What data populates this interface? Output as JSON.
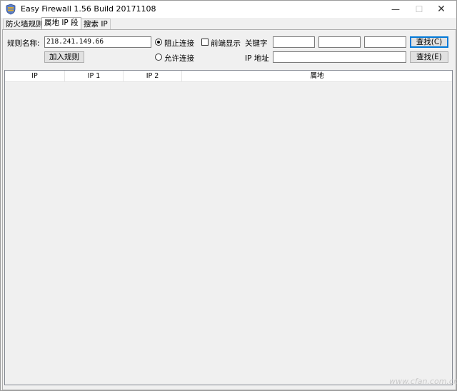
{
  "window": {
    "title": "Easy Firewall 1.56 Build 20171108",
    "minimize": "—",
    "maximize": "☐",
    "close": "✕"
  },
  "tabs": [
    {
      "label": "防火墙规则"
    },
    {
      "label": "属地 IP 段"
    },
    {
      "label": "搜索 IP"
    }
  ],
  "form": {
    "rule_name_label": "规则名称:",
    "rule_name_value": "218.241.149.66",
    "add_rule_button": "加入规则",
    "block_label": "阻止连接",
    "allow_label": "允许连接",
    "front_display_label": "前端显示",
    "keyword_label": "关键字",
    "ip_address_label": "IP 地址",
    "keyword_values": [
      "",
      "",
      ""
    ],
    "ip_address_value": "",
    "search_c_button": "查找(C)",
    "search_e_button": "查找(E)"
  },
  "table": {
    "columns": [
      "IP",
      "IP 1",
      "IP 2",
      "属地"
    ],
    "rows": []
  },
  "watermark": "www.cfan.com.cn",
  "colors": {
    "accent": "#0078d7",
    "icon_shield": "#5b7fc7",
    "icon_gold": "#d8a830"
  },
  "icons": {
    "app": "shield-icon"
  },
  "state": {
    "block_selected": true,
    "allow_selected": false,
    "front_display_checked": false,
    "active_tab": 1
  }
}
